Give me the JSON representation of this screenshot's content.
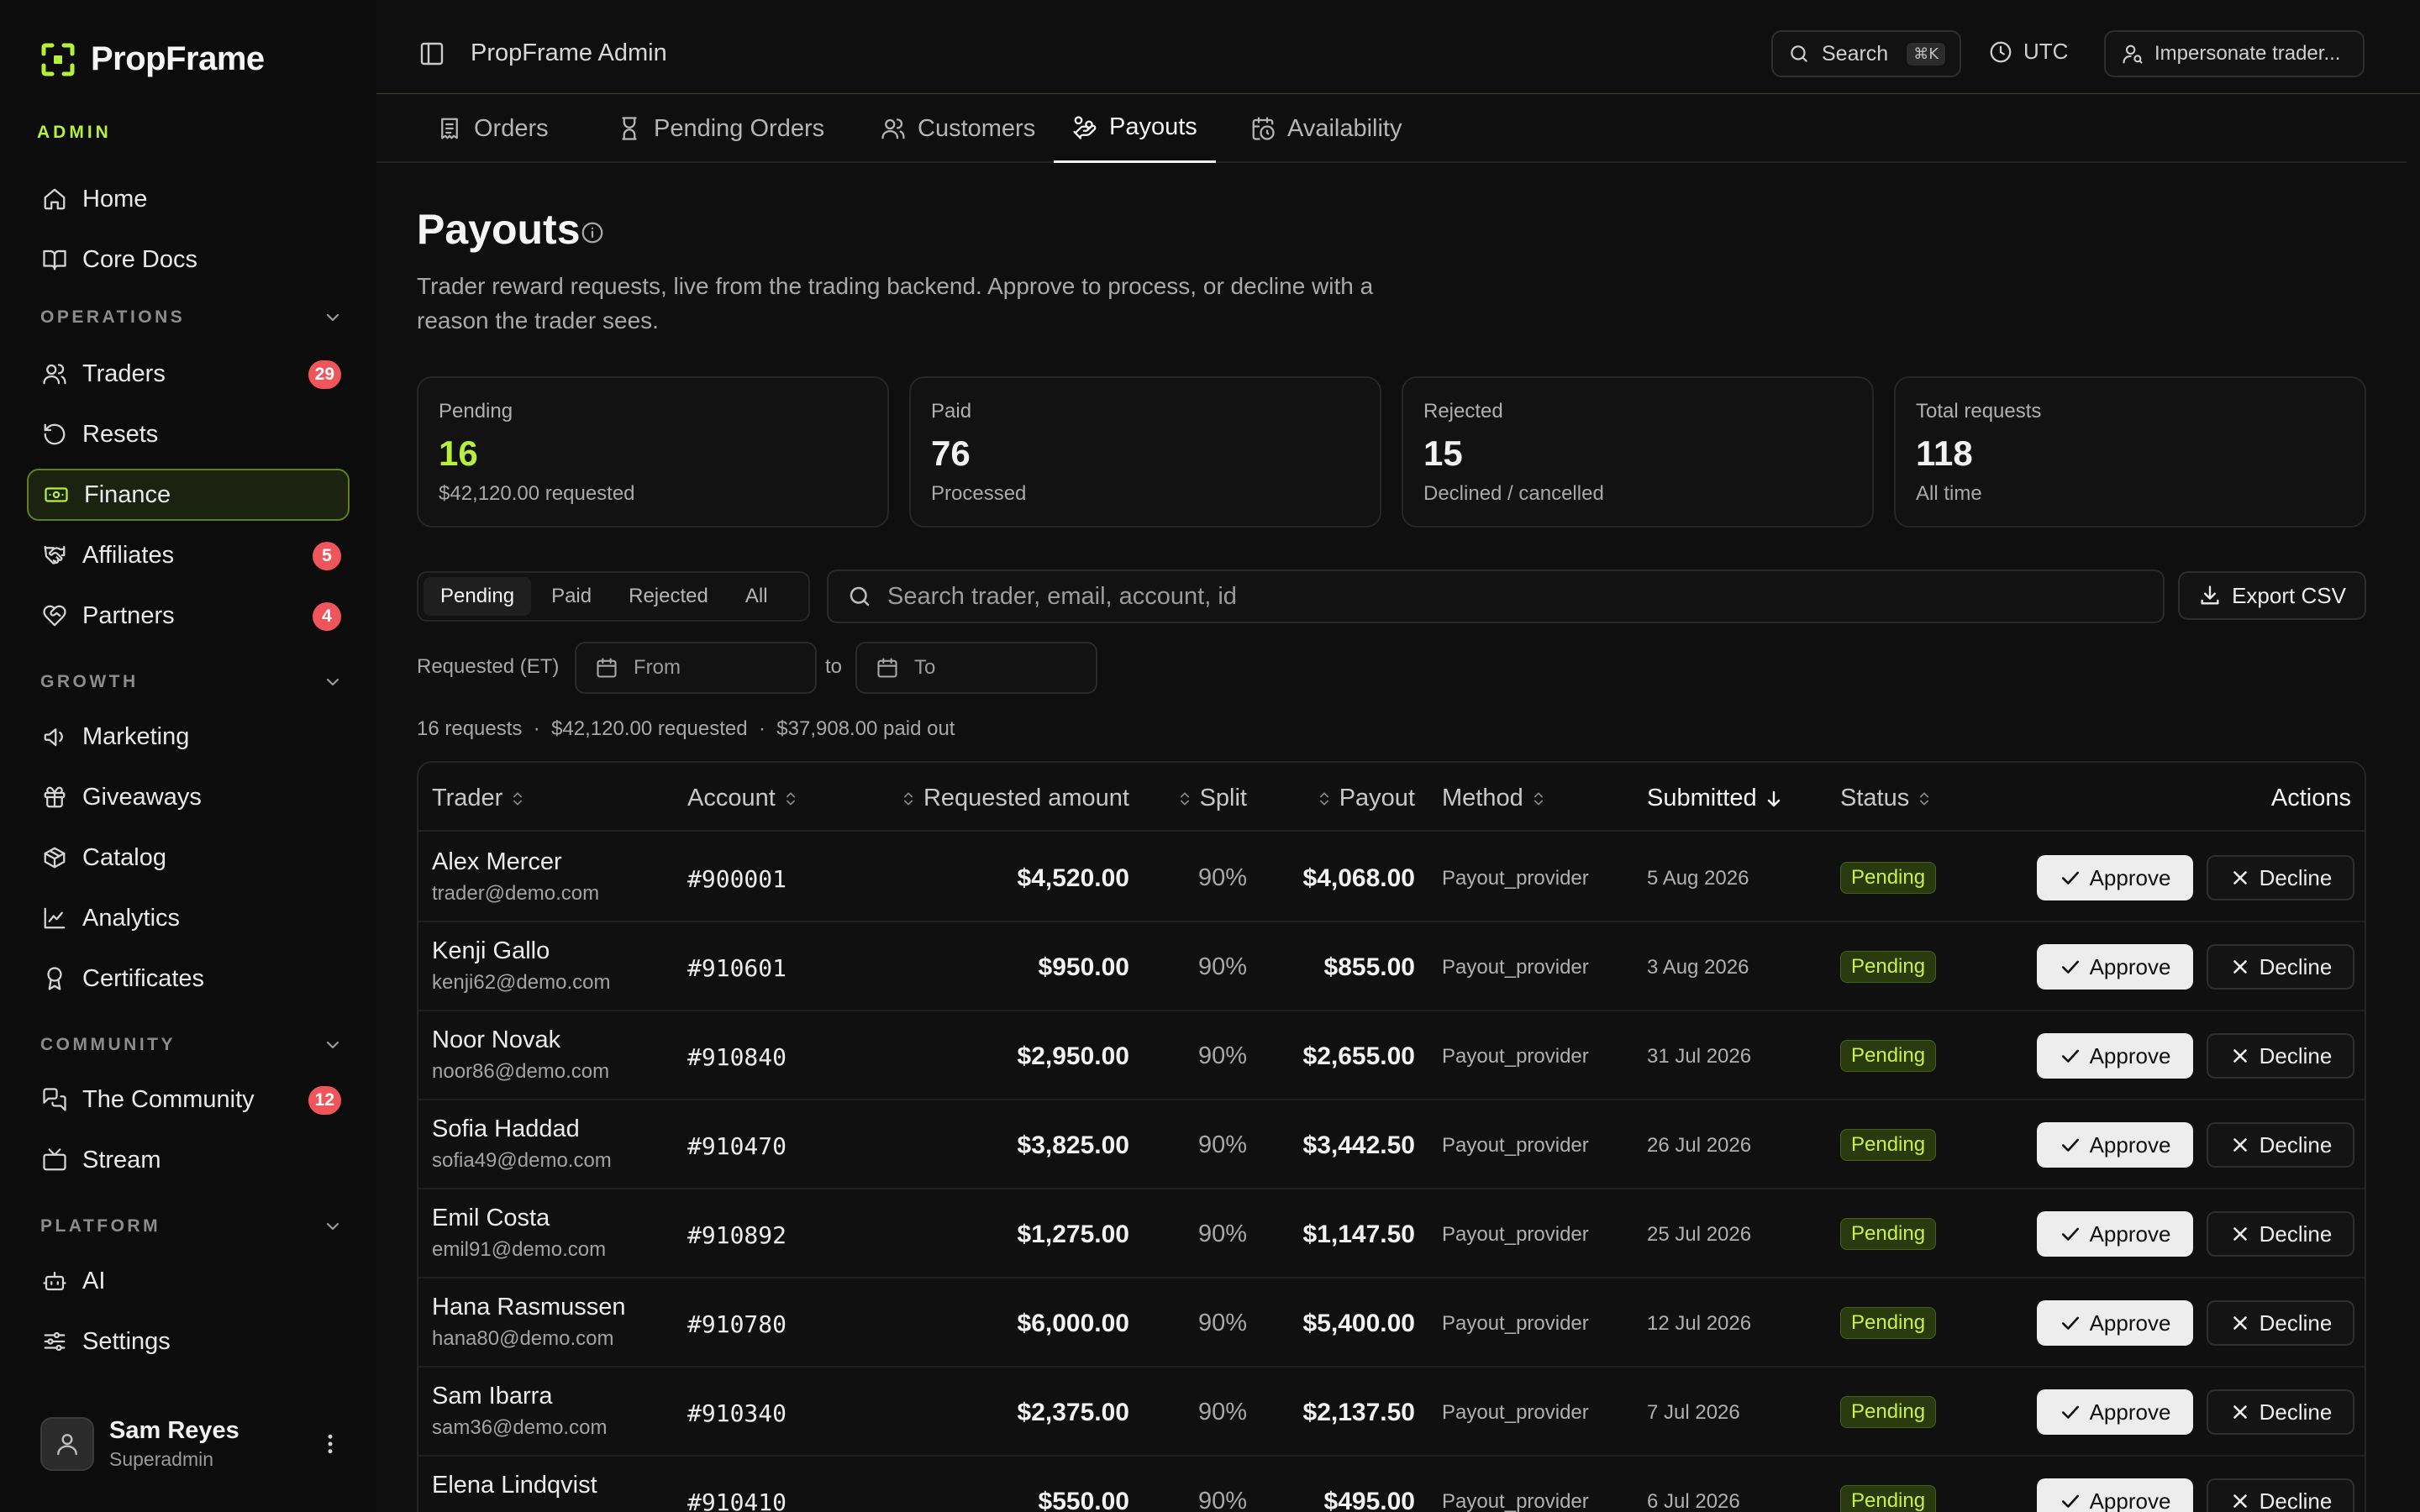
{
  "brand": {
    "name": "PropFrame"
  },
  "sidebar": {
    "admin_label": "ADMIN",
    "items": [
      {
        "label": "Home"
      },
      {
        "label": "Core Docs"
      }
    ],
    "sections": [
      {
        "label": "OPERATIONS",
        "items": [
          {
            "label": "Traders",
            "badge": "29"
          },
          {
            "label": "Resets"
          },
          {
            "label": "Finance",
            "active": true
          },
          {
            "label": "Affiliates",
            "badge": "5"
          },
          {
            "label": "Partners",
            "badge": "4"
          }
        ]
      },
      {
        "label": "GROWTH",
        "items": [
          {
            "label": "Marketing"
          },
          {
            "label": "Giveaways"
          },
          {
            "label": "Catalog"
          },
          {
            "label": "Analytics"
          },
          {
            "label": "Certificates"
          }
        ]
      },
      {
        "label": "COMMUNITY",
        "items": [
          {
            "label": "The Community",
            "badge": "12"
          },
          {
            "label": "Stream"
          }
        ]
      },
      {
        "label": "PLATFORM",
        "items": [
          {
            "label": "AI"
          },
          {
            "label": "Settings"
          }
        ]
      }
    ],
    "user": {
      "name": "Sam Reyes",
      "role": "Superadmin"
    }
  },
  "header": {
    "title": "PropFrame Admin",
    "search_label": "Search",
    "search_shortcut": "⌘K",
    "timezone": "UTC",
    "impersonate_label": "Impersonate trader..."
  },
  "tabs": [
    {
      "label": "Orders"
    },
    {
      "label": "Pending Orders"
    },
    {
      "label": "Customers"
    },
    {
      "label": "Payouts",
      "active": true
    },
    {
      "label": "Availability"
    }
  ],
  "page": {
    "title": "Payouts",
    "description": "Trader reward requests, live from the trading backend. Approve to process, or decline with a reason the trader sees."
  },
  "stats": [
    {
      "label": "Pending",
      "value": "16",
      "sub": "$42,120.00 requested"
    },
    {
      "label": "Paid",
      "value": "76",
      "sub": "Processed"
    },
    {
      "label": "Rejected",
      "value": "15",
      "sub": "Declined / cancelled"
    },
    {
      "label": "Total requests",
      "value": "118",
      "sub": "All time"
    }
  ],
  "filters": {
    "segments": [
      "Pending",
      "Paid",
      "Rejected",
      "All"
    ],
    "active_segment": "Pending",
    "search_placeholder": "Search trader, email, account, id",
    "export_label": "Export CSV",
    "date_label": "Requested (ET)",
    "from_placeholder": "From",
    "to_label": "to",
    "to_placeholder": "To"
  },
  "summary": "16 requests  ·  $42,120.00 requested  ·  $37,908.00 paid out",
  "table": {
    "columns": {
      "trader": "Trader",
      "account": "Account",
      "requested": "Requested amount",
      "split": "Split",
      "payout": "Payout",
      "method": "Method",
      "submitted": "Submitted",
      "status": "Status",
      "actions": "Actions"
    },
    "approve_label": "Approve",
    "decline_label": "Decline",
    "rows": [
      {
        "name": "Alex Mercer",
        "email": "trader@demo.com",
        "account": "#900001",
        "requested": "$4,520.00",
        "split": "90%",
        "payout": "$4,068.00",
        "method": "Payout_provider",
        "submitted": "5 Aug 2026",
        "status": "Pending"
      },
      {
        "name": "Kenji Gallo",
        "email": "kenji62@demo.com",
        "account": "#910601",
        "requested": "$950.00",
        "split": "90%",
        "payout": "$855.00",
        "method": "Payout_provider",
        "submitted": "3 Aug 2026",
        "status": "Pending"
      },
      {
        "name": "Noor Novak",
        "email": "noor86@demo.com",
        "account": "#910840",
        "requested": "$2,950.00",
        "split": "90%",
        "payout": "$2,655.00",
        "method": "Payout_provider",
        "submitted": "31 Jul 2026",
        "status": "Pending"
      },
      {
        "name": "Sofia Haddad",
        "email": "sofia49@demo.com",
        "account": "#910470",
        "requested": "$3,825.00",
        "split": "90%",
        "payout": "$3,442.50",
        "method": "Payout_provider",
        "submitted": "26 Jul 2026",
        "status": "Pending"
      },
      {
        "name": "Emil Costa",
        "email": "emil91@demo.com",
        "account": "#910892",
        "requested": "$1,275.00",
        "split": "90%",
        "payout": "$1,147.50",
        "method": "Payout_provider",
        "submitted": "25 Jul 2026",
        "status": "Pending"
      },
      {
        "name": "Hana Rasmussen",
        "email": "hana80@demo.com",
        "account": "#910780",
        "requested": "$6,000.00",
        "split": "90%",
        "payout": "$5,400.00",
        "method": "Payout_provider",
        "submitted": "12 Jul 2026",
        "status": "Pending"
      },
      {
        "name": "Sam Ibarra",
        "email": "sam36@demo.com",
        "account": "#910340",
        "requested": "$2,375.00",
        "split": "90%",
        "payout": "$2,137.50",
        "method": "Payout_provider",
        "submitted": "7 Jul 2026",
        "status": "Pending"
      },
      {
        "name": "Elena Lindqvist",
        "email": "",
        "account": "#910410",
        "requested": "$550.00",
        "split": "90%",
        "payout": "$495.00",
        "method": "Payout_provider",
        "submitted": "6 Jul 2026",
        "status": "Pending"
      }
    ]
  },
  "colors": {
    "accent": "#b7f03a",
    "badge": "#f0555b",
    "background": "#0f0f0f"
  }
}
